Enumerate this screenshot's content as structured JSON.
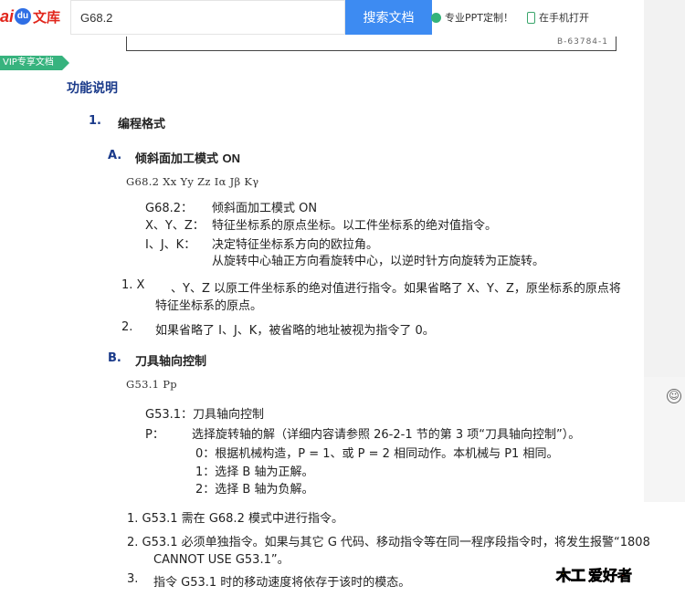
{
  "header": {
    "logo_letters": "ai",
    "logo_badge": "du",
    "logo_text": "文库",
    "search_value": "G68.2",
    "search_button": "搜索文档",
    "promo_ppt": "专业PPT定制！",
    "promo_mobile": "在手机打开"
  },
  "doc_frame_code": "B-63784-1",
  "vip_tag": "VIP专享文档",
  "document": {
    "section_title": "功能说明",
    "item1_num": "1.",
    "item1_title": "编程格式",
    "a_label": "A.",
    "a_title": "倾斜面加工模式",
    "a_title_on": "ON",
    "a_syntax": "G68.2 Xx Yy Zz Iα Jβ Kγ",
    "a_param_g_key": "G68.2：",
    "a_param_g_val": "倾斜面加工模式 ON",
    "a_param_xyz_key": "X、Y、Z：",
    "a_param_xyz_val": "特征坐标系的原点坐标。以工件坐标系的绝对值指令。",
    "a_param_ijk_key": "I、J、K：",
    "a_param_ijk_val": "决定特征坐标系方向的欧拉角。",
    "a_param_ijk_val2": "从旋转中心轴正方向看旋转中心，以逆时针方向旋转为正旋转。",
    "a_note1_num": "1. X",
    "a_note1_text": "、Y、Z 以原工件坐标系的绝对值进行指令。如果省略了 X、Y、Z，原坐标系的原点将",
    "a_note1_text2": "特征坐标系的原点。",
    "a_note2_num": "2.",
    "a_note2_text": "如果省略了 I、J、K，被省略的地址被视为指令了 0。",
    "b_label": "B.",
    "b_title": "刀具轴向控制",
    "b_syntax": "G53.1 Pp",
    "b_param_g": "G53.1：刀具轴向控制",
    "b_param_p_key": "P：",
    "b_param_p_val": "选择旋转轴的解（详细内容请参照 26-2-1 节的第 3 项“刀具轴向控制”）。",
    "b_opt0": "0：根据机械构造，P = 1、或 P = 2 相同动作。本机械与 P1 相同。",
    "b_opt1": "1：选择 B 轴为正解。",
    "b_opt2": "2：选择 B 轴为负解。",
    "b_note1": "1. G53.1    需在 G68.2 模式中进行指令。",
    "b_note2": "2. G53.1    必须单独指令。如果与其它 G 代码、移动指令等在同一程序段指令时，将发生报警“1808",
    "b_note2_cont": "CANNOT USE G53.1”。",
    "b_note3_num": "3.",
    "b_note3_text": "指令 G53.1 时的移动速度将依存于该时的模态。"
  },
  "corner_logo": {
    "part1": "木工",
    "part2": "爱好者"
  },
  "colors": {
    "accent_blue": "#3d8bf2",
    "heading_blue": "#1a3a8a",
    "vip_green": "#37b37e",
    "brand_red": "#e1251b"
  }
}
